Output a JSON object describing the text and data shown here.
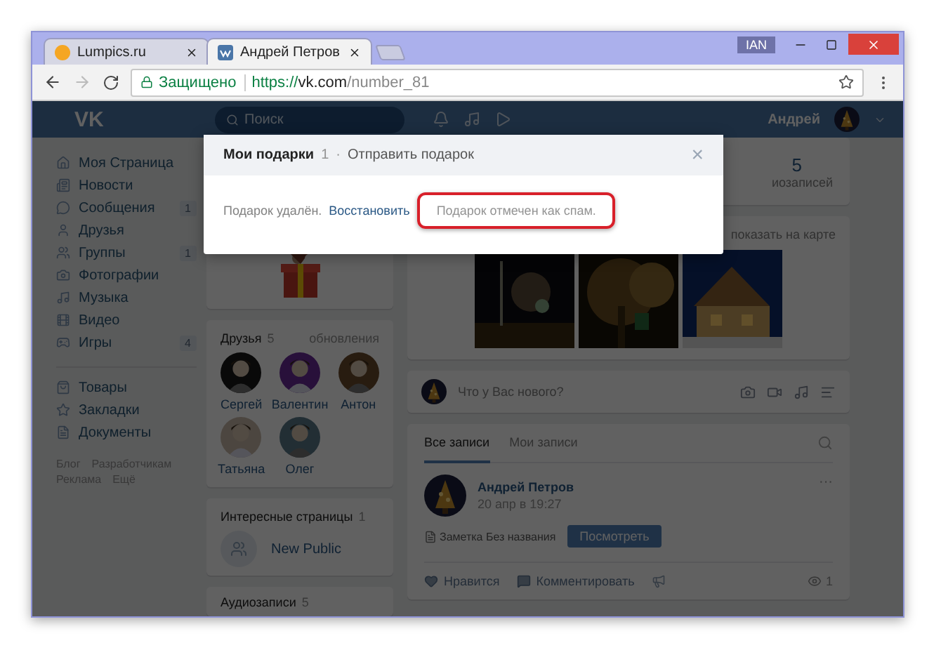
{
  "browser": {
    "tabs": [
      {
        "title": "Lumpics.ru",
        "selected": false
      },
      {
        "title": "Андрей Петров",
        "selected": true
      }
    ],
    "profile_badge": "IAN",
    "address": {
      "secure_label": "Защищено",
      "scheme": "https://",
      "host": "vk.com",
      "path": "/number_81"
    }
  },
  "header": {
    "logo": "VK",
    "search_placeholder": "Поиск",
    "user_name": "Андрей"
  },
  "sidebar": {
    "sections": [
      [
        {
          "label": "Моя Страница"
        },
        {
          "label": "Новости"
        },
        {
          "label": "Сообщения",
          "count": "1"
        },
        {
          "label": "Друзья"
        },
        {
          "label": "Группы",
          "count": "1"
        },
        {
          "label": "Фотографии"
        },
        {
          "label": "Музыка"
        },
        {
          "label": "Видео"
        },
        {
          "label": "Игры",
          "count": "4"
        }
      ],
      [
        {
          "label": "Товары"
        },
        {
          "label": "Закладки"
        },
        {
          "label": "Документы"
        }
      ]
    ],
    "footer_links": [
      "Блог",
      "Разработчикам",
      "Реклама",
      "Ещё"
    ]
  },
  "friends": {
    "title": "Друзья",
    "count": "5",
    "link": "обновления",
    "people": [
      {
        "name": "Сергей"
      },
      {
        "name": "Валентин"
      },
      {
        "name": "Антон"
      },
      {
        "name": "Татьяна"
      },
      {
        "name": "Олег"
      }
    ]
  },
  "interesting": {
    "title": "Интересные страницы",
    "count": "1",
    "pages": [
      {
        "name": "New Public"
      }
    ]
  },
  "audio": {
    "title": "Аудиозаписи",
    "count": "5"
  },
  "stats": {
    "value": "5",
    "label": "иозаписей"
  },
  "photos": {
    "map_link": "показать на карте"
  },
  "composer": {
    "placeholder": "Что у Вас нового?"
  },
  "wall": {
    "tabs": [
      {
        "label": "Все записи",
        "selected": true
      },
      {
        "label": "Мои записи",
        "selected": false
      }
    ],
    "post": {
      "author": "Андрей Петров",
      "date": "20 апр в 19:27",
      "attachment": "Заметка Без названия",
      "button": "Посмотреть",
      "more": "···",
      "like": "Нравится",
      "comment": "Комментировать",
      "views": "1"
    }
  },
  "modal": {
    "title": "Мои подарки",
    "count": "1",
    "separator": "·",
    "link": "Отправить подарок",
    "close": "×",
    "status": "Подарок удалён.",
    "restore": "Восстановить",
    "spam_notice": "Подарок отмечен как спам."
  }
}
